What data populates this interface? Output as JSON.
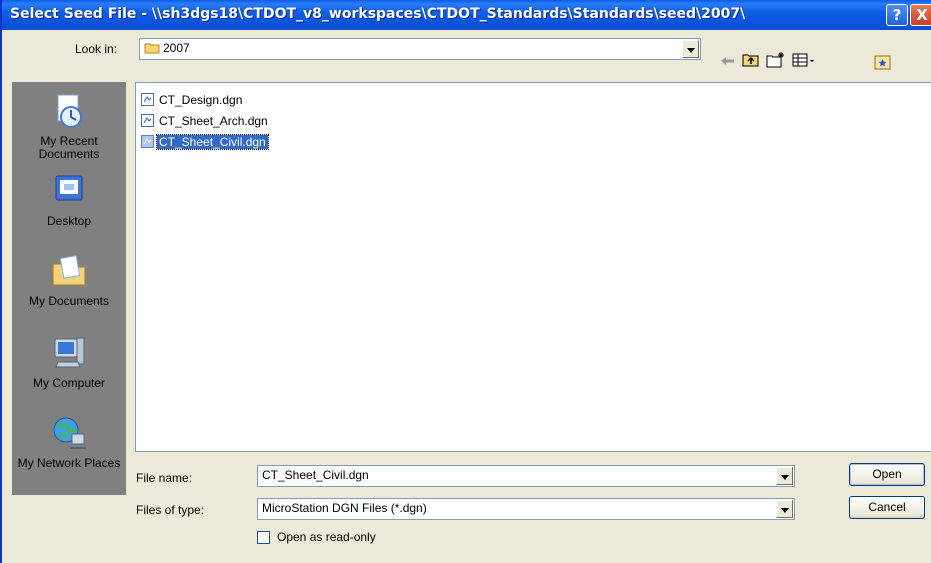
{
  "window": {
    "title": "Select Seed File - \\\\sh3dgs18\\CTDOT_v8_workspaces\\CTDOT_Standards\\Standards\\seed\\2007\\",
    "help_label": "?",
    "close_label": "X"
  },
  "lookin": {
    "label": "Look in:",
    "value": "2007"
  },
  "places": [
    {
      "label": "My Recent Documents",
      "icon": "recent-documents-icon"
    },
    {
      "label": "Desktop",
      "icon": "desktop-icon"
    },
    {
      "label": "My Documents",
      "icon": "my-documents-icon"
    },
    {
      "label": "My Computer",
      "icon": "my-computer-icon"
    },
    {
      "label": "My Network Places",
      "icon": "network-places-icon"
    }
  ],
  "files": [
    {
      "name": "CT_Design.dgn",
      "selected": false
    },
    {
      "name": "CT_Sheet_Arch.dgn",
      "selected": false
    },
    {
      "name": "CT_Sheet_Civil.dgn",
      "selected": true
    }
  ],
  "filename": {
    "label": "File name:",
    "value": "CT_Sheet_Civil.dgn"
  },
  "filetype": {
    "label": "Files of type:",
    "value": "MicroStation DGN Files (*.dgn)"
  },
  "buttons": {
    "open": "Open",
    "cancel": "Cancel"
  },
  "readonly": {
    "label": "Open as read-only",
    "checked": false
  },
  "colors": {
    "titlebar": "#0a5be8",
    "selection": "#316ac5",
    "places_bar": "#808080",
    "dialog_bg": "#ece9d8"
  }
}
